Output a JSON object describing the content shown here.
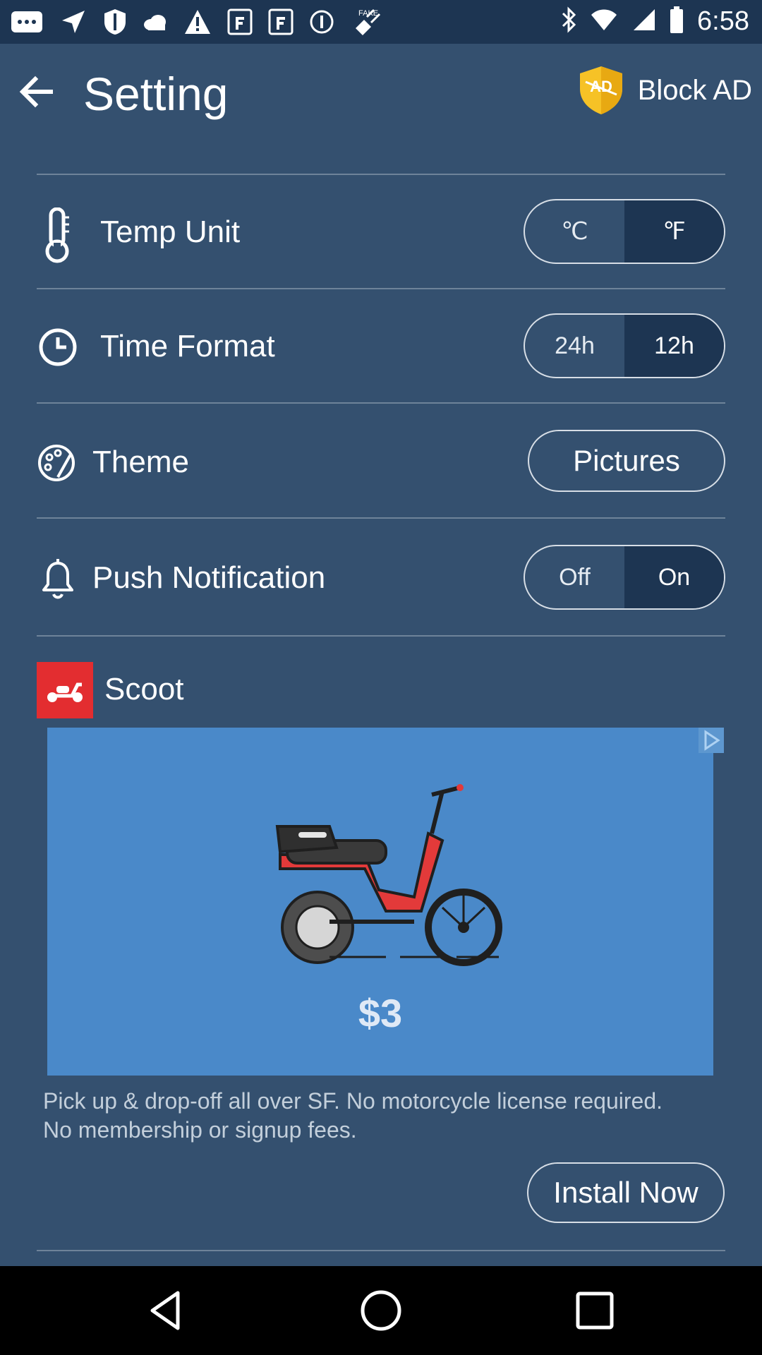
{
  "status_bar": {
    "time": "6:58"
  },
  "header": {
    "title": "Setting",
    "block_ad_badge": "AD",
    "block_ad_label": "Block AD"
  },
  "settings": {
    "temp_unit": {
      "label": "Temp Unit",
      "options": [
        "℃",
        "℉"
      ],
      "selected": "℉"
    },
    "time_format": {
      "label": "Time Format",
      "options": [
        "24h",
        "12h"
      ],
      "selected": "12h"
    },
    "theme": {
      "label": "Theme",
      "value": "Pictures"
    },
    "push_notification": {
      "label": "Push Notification",
      "options": [
        "Off",
        "On"
      ],
      "selected": "On"
    }
  },
  "ad": {
    "name": "Scoot",
    "price": "$3",
    "description": "Pick up & drop-off all over SF. No motorcycle license required. No membership or signup fees.",
    "cta": "Install Now"
  },
  "colors": {
    "background": "#34506f",
    "status_bar": "#1d3552",
    "ad_background": "#4a89c9",
    "ad_logo": "#e32d30"
  }
}
